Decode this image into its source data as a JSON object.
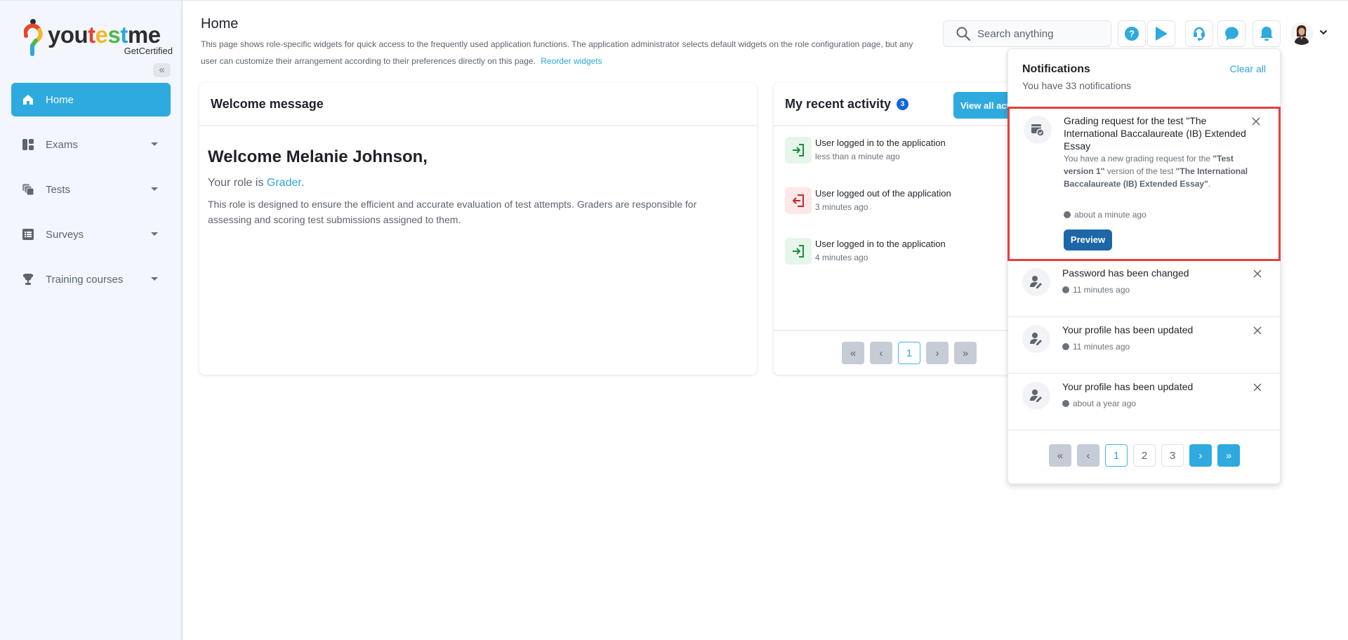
{
  "brand": {
    "name_parts": [
      "you",
      "t",
      "e",
      "s",
      "t",
      "me"
    ],
    "tagline": "GetCertified"
  },
  "sidebar": {
    "collapse_icon": "double-chevron-left-icon",
    "items": [
      {
        "label": "Home",
        "icon": "home-icon",
        "active": true
      },
      {
        "label": "Exams",
        "icon": "dashboard-icon"
      },
      {
        "label": "Tests",
        "icon": "stacked-cards-icon"
      },
      {
        "label": "Surveys",
        "icon": "list-icon"
      },
      {
        "label": "Training courses",
        "icon": "trophy-icon"
      }
    ]
  },
  "header": {
    "title": "Home",
    "description": "This page shows role-specific widgets for quick access to the frequently used application functions. The application administrator selects default widgets on the role configuration page, but any user can customize their arrangement according to their preferences directly on this page.",
    "reorder_link": "Reorder widgets",
    "search_placeholder": "Search anything",
    "toolbar": [
      "help-icon",
      "play-icon",
      "headset-icon",
      "chat-icon",
      "bell-icon"
    ]
  },
  "welcome_widget": {
    "title": "Welcome message",
    "greeting": "Welcome Melanie Johnson,",
    "role_prefix": "Your role is ",
    "role": "Grader",
    "role_suffix": ".",
    "description": "This role is designed to ensure the efficient and accurate evaluation of test attempts. Graders are responsible for assessing and scoring test submissions assigned to them."
  },
  "activity_widget": {
    "title": "My recent activity",
    "count": "3",
    "view_all": "View all activities",
    "items": [
      {
        "type": "login",
        "title": "User logged in to the application",
        "time": "less than a minute ago"
      },
      {
        "type": "logout",
        "title": "User logged out of the application",
        "time": "3 minutes ago"
      },
      {
        "type": "login",
        "title": "User logged in to the application",
        "time": "4 minutes ago"
      }
    ],
    "pagination": {
      "current": "1"
    }
  },
  "notifications": {
    "title": "Notifications",
    "subtitle": "You have 33 notifications",
    "clear_all": "Clear all",
    "items": [
      {
        "icon": "grading-calendar-check-icon",
        "title": "Grading request for the test \"The International Baccalaureate (IB) Extended Essay",
        "body_prefix": "You have a new grading request for the ",
        "body_version": "\"Test version 1\"",
        "body_middle": " version of the test ",
        "body_test": "\"The International Baccalaureate (IB) Extended Essay\"",
        "body_suffix": ".",
        "time": "about a minute ago",
        "action": "Preview",
        "highlighted": true
      },
      {
        "icon": "user-edit-icon",
        "title": "Password has been changed",
        "time": "11 minutes ago"
      },
      {
        "icon": "user-edit-icon",
        "title": "Your profile has been updated",
        "time": "11 minutes ago"
      },
      {
        "icon": "user-edit-icon",
        "title": "Your profile has been updated",
        "time": "about a year ago"
      }
    ],
    "pagination": {
      "pages": [
        "1",
        "2",
        "3"
      ],
      "current": "1"
    }
  },
  "colors": {
    "accent": "#2eaadf",
    "highlight_border": "#e5413c",
    "preview_button": "#1d67a8",
    "badge": "#1565e0"
  }
}
